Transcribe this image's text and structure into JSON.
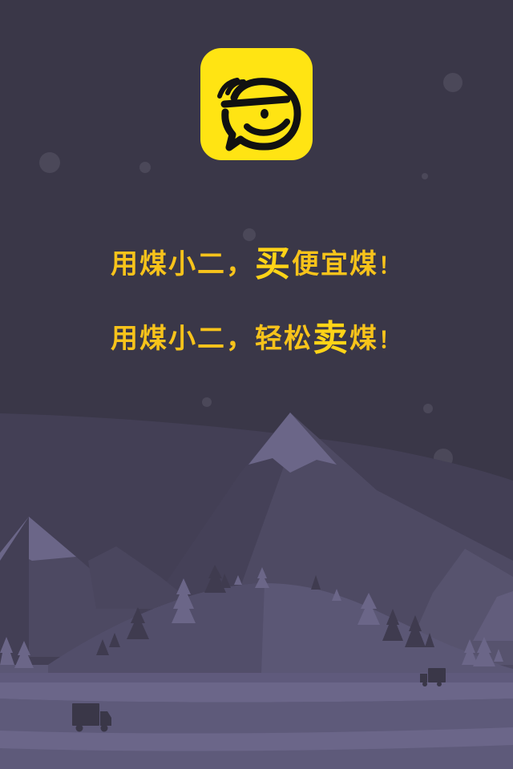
{
  "splash": {
    "app_icon": "coal-mascot-icon",
    "colors": {
      "background": "#3a3748",
      "accent": "#ffe413",
      "slogan": "#f7c31b"
    },
    "slogan_1": {
      "part_a": "用煤小二，",
      "highlight": "买",
      "part_b": "便宜煤",
      "end": "！"
    },
    "slogan_2": {
      "part_a": "用煤小二，轻松",
      "highlight": "卖",
      "part_b": "煤",
      "end": "！"
    }
  }
}
